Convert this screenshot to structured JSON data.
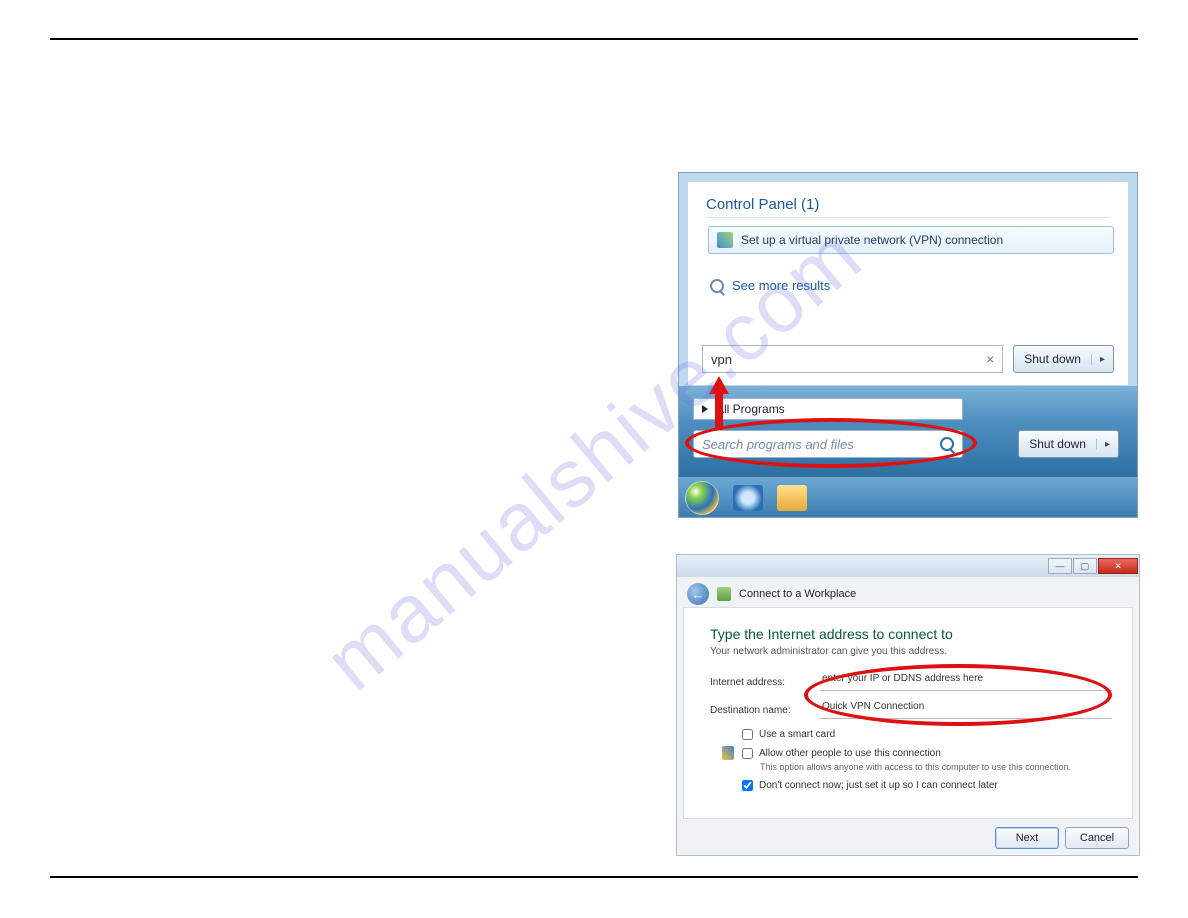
{
  "watermark": "manualshive.com",
  "startmenu": {
    "group_header": "Control Panel (1)",
    "item_label": "Set up a virtual private network (VPN) connection",
    "see_more": "See more results",
    "search_value": "vpn",
    "shutdown_label": "Shut down",
    "all_programs": "All Programs",
    "search_placeholder": "Search programs and files"
  },
  "wizard": {
    "title": "Connect to a Workplace",
    "heading": "Type the Internet address to connect to",
    "subheading": "Your network administrator can give you this address.",
    "fld_internet_label": "Internet address:",
    "fld_internet_value": "enter your IP or DDNS address here",
    "fld_dest_label": "Destination name:",
    "fld_dest_value": "Quick VPN Connection",
    "chk_smartcard": "Use a smart card",
    "chk_allow": "Allow other people to use this connection",
    "chk_allow_hint": "This option allows anyone with access to this computer to use this connection.",
    "chk_dontconnect": "Don't connect now; just set it up so I can connect later",
    "btn_next": "Next",
    "btn_cancel": "Cancel"
  }
}
